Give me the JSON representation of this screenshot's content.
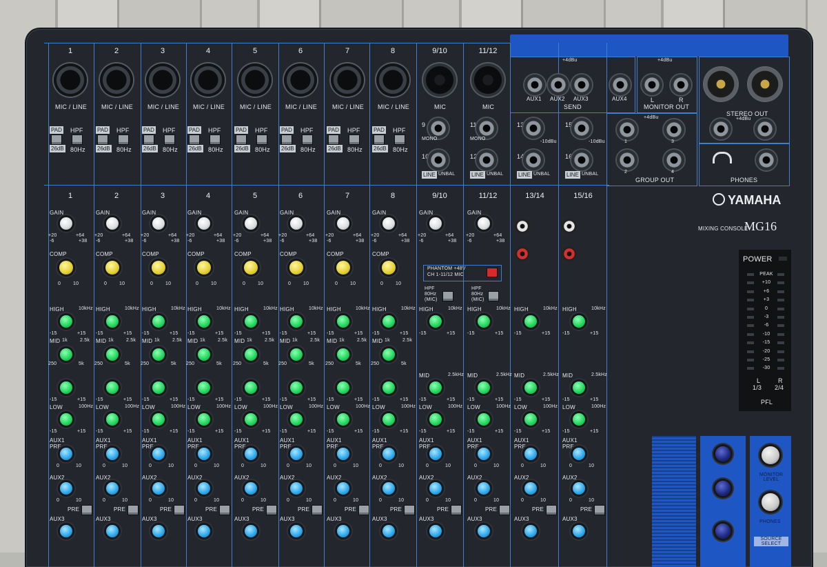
{
  "brand": {
    "name": "YAMAHA",
    "model_caption": "MIXING CONSOLE",
    "model": "MG16"
  },
  "channels": {
    "top_numbers": [
      "1",
      "2",
      "3",
      "4",
      "5",
      "6",
      "7",
      "8",
      "9/10",
      "11/12"
    ],
    "mic_line_label": "MIC / LINE",
    "mic_label": "MIC",
    "pad_label": "PAD",
    "pad_value": "26dB",
    "hpf_label": "HPF",
    "hpf_value": "80Hz",
    "strip_numbers": [
      "1",
      "2",
      "3",
      "4",
      "5",
      "6",
      "7",
      "8",
      "9/10",
      "11/12",
      "13/14",
      "15/16"
    ]
  },
  "stereo_inputs": {
    "mono_label": "MONO",
    "line_label": "LINE",
    "unbal_label": "UNBAL",
    "level_10dbu": "-10dBu",
    "jack_numbers": [
      "9",
      "10",
      "11",
      "12",
      "13",
      "14",
      "15",
      "16"
    ],
    "l_label": "L",
    "r_label": "R"
  },
  "outputs": {
    "plus4": "+4dBu",
    "aux_sends": [
      "AUX1",
      "AUX2",
      "AUX3",
      "AUX4"
    ],
    "send_label": "SEND",
    "monitor_out": "MONITOR OUT",
    "stereo_out": "STEREO OUT",
    "group_out": "GROUP OUT",
    "group_numbers": [
      "1",
      "2",
      "3",
      "4"
    ],
    "phones": "PHONES"
  },
  "controls": {
    "gain": "GAIN",
    "gain_left": "+20",
    "gain_right": "+64",
    "gain_min": "-6",
    "gain_max": "+38",
    "comp": "COMP",
    "comp_min": "0",
    "comp_max": "10",
    "high": "HIGH",
    "high_freq": "10kHz",
    "mid": "MID",
    "mid_freq_a": "1k",
    "mid_freq_b": "2.5k",
    "mid_freq_c": "250",
    "mid_freq_d": "5k",
    "mid_fixed": "2.5kHz",
    "low": "LOW",
    "low_freq": "100Hz",
    "eq_min": "-15",
    "eq_max": "+15",
    "aux1": "AUX1",
    "aux2": "AUX2",
    "aux3": "AUX3",
    "pre": "PRE",
    "aux_min": "0",
    "aux_max": "10"
  },
  "phantom": {
    "line1": "PHANTOM +48V",
    "line2": "CH 1-11/12 MIC"
  },
  "hpf_mic": {
    "line1": "HPF",
    "line2": "80Hz",
    "line3": "(MIC)"
  },
  "meter": {
    "power": "POWER",
    "scale": [
      "PEAK",
      "+10",
      "+6",
      "+3",
      "0",
      "-3",
      "-6",
      "-10",
      "-15",
      "-20",
      "-25",
      "-30"
    ],
    "l": "L",
    "r": "R",
    "l_sub": "1/3",
    "r_sub": "2/4",
    "pfl": "PFL"
  },
  "master": {
    "monitor_level": "MONITOR LEVEL",
    "phones_label": "PHONES",
    "source_select": "SOURCE SELECT"
  },
  "colors": {
    "eq_knob": "#1fd45a",
    "aux_knob": "#2aa6ea",
    "comp_knob": "#e3cf32",
    "accent_blue": "#1e57c4",
    "panel": "#23272d"
  }
}
